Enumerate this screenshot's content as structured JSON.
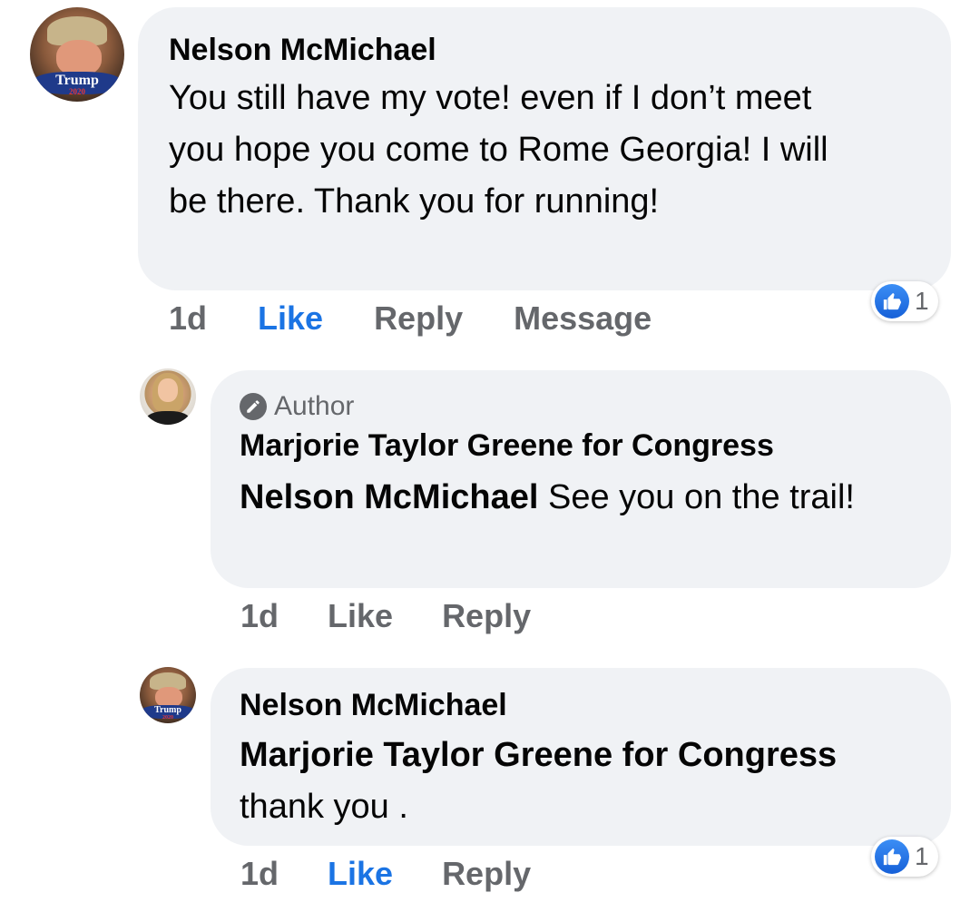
{
  "comments": [
    {
      "author": "Nelson McMichael",
      "text": "You still have my vote! even if I don’t meet you hope you come to Rome Georgia! I will be there. Thank you for running!",
      "time": "1d",
      "like_label": "Like",
      "reply_label": "Reply",
      "message_label": "Message",
      "reaction_count": "1",
      "avatar_badge": "Trump",
      "avatar_badge_sub": "2020"
    },
    {
      "badge": "Author",
      "author": "Marjorie Taylor Greene for Congress",
      "mention": "Nelson McMichael",
      "text": " See you on the trail!",
      "time": "1d",
      "like_label": "Like",
      "reply_label": "Reply"
    },
    {
      "author": "Nelson McMichael",
      "mention": "Marjorie Taylor Greene for Congress",
      "text": "thank you .",
      "time": "1d",
      "like_label": "Like",
      "reply_label": "Reply",
      "reaction_count": "1",
      "avatar_badge": "Trump",
      "avatar_badge_sub": "2020"
    }
  ],
  "icons": {
    "like_reaction": "thumbs-up-icon",
    "author_badge": "pencil-icon"
  },
  "colors": {
    "bubble": "#f0f2f5",
    "like_active": "#1b74e4",
    "meta_text": "#65676b"
  }
}
